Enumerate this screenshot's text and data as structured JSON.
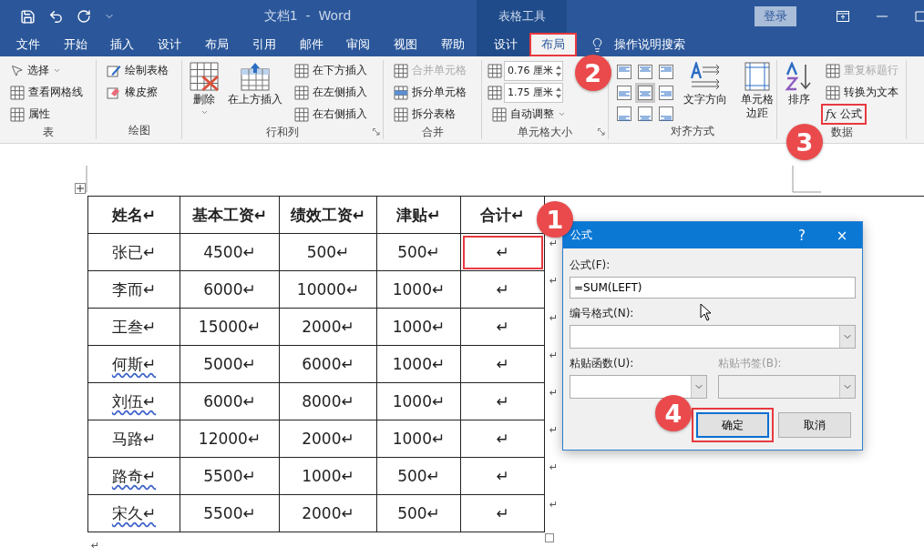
{
  "title_bar": {
    "document_title": "文档1  -  Word",
    "context_label": "表格工具",
    "login_button": "登录"
  },
  "tabs": [
    {
      "label": "文件",
      "kind": "main",
      "selected": false,
      "highlighted": false
    },
    {
      "label": "开始",
      "kind": "main",
      "selected": false,
      "highlighted": false
    },
    {
      "label": "插入",
      "kind": "main",
      "selected": false,
      "highlighted": false
    },
    {
      "label": "设计",
      "kind": "main",
      "selected": false,
      "highlighted": false
    },
    {
      "label": "布局",
      "kind": "main",
      "selected": false,
      "highlighted": false
    },
    {
      "label": "引用",
      "kind": "main",
      "selected": false,
      "highlighted": false
    },
    {
      "label": "邮件",
      "kind": "main",
      "selected": false,
      "highlighted": false
    },
    {
      "label": "审阅",
      "kind": "main",
      "selected": false,
      "highlighted": false
    },
    {
      "label": "视图",
      "kind": "main",
      "selected": false,
      "highlighted": false
    },
    {
      "label": "帮助",
      "kind": "main",
      "selected": false,
      "highlighted": false
    },
    {
      "label": "设计",
      "kind": "context",
      "selected": false,
      "highlighted": false
    },
    {
      "label": "布局",
      "kind": "context",
      "selected": true,
      "highlighted": true,
      "callout": "2"
    }
  ],
  "tell_me": "操作说明搜索",
  "ribbon": {
    "groups": [
      {
        "label": "表",
        "launcher": false,
        "columns": [
          {
            "kind": "stack",
            "items": [
              {
                "kind": "button",
                "label": "选择",
                "dropdown": true,
                "disabled": false,
                "highlighted": false
              },
              {
                "kind": "button",
                "label": "查看网格线",
                "dropdown": false,
                "disabled": false,
                "highlighted": false
              },
              {
                "kind": "button",
                "label": "属性",
                "dropdown": false,
                "disabled": false,
                "highlighted": false
              }
            ]
          }
        ]
      },
      {
        "label": "绘图",
        "launcher": false,
        "columns": [
          {
            "kind": "stack",
            "items": [
              {
                "kind": "button",
                "label": "绘制表格",
                "dropdown": false,
                "disabled": false,
                "highlighted": false
              },
              {
                "kind": "button",
                "label": "橡皮擦",
                "dropdown": false,
                "disabled": false,
                "highlighted": false
              }
            ]
          }
        ]
      },
      {
        "label": "行和列",
        "launcher": true,
        "columns": [
          {
            "kind": "large",
            "label": "删除",
            "dropdown": true
          },
          {
            "kind": "large",
            "label": "在上方插入",
            "dropdown": false
          },
          {
            "kind": "stack",
            "items": [
              {
                "kind": "button",
                "label": "在下方插入",
                "dropdown": false,
                "disabled": false,
                "highlighted": false
              },
              {
                "kind": "button",
                "label": "在左侧插入",
                "dropdown": false,
                "disabled": false,
                "highlighted": false
              },
              {
                "kind": "button",
                "label": "在右侧插入",
                "dropdown": false,
                "disabled": false,
                "highlighted": false
              }
            ]
          }
        ]
      },
      {
        "label": "合并",
        "launcher": false,
        "columns": [
          {
            "kind": "stack",
            "items": [
              {
                "kind": "button",
                "label": "合并单元格",
                "dropdown": false,
                "disabled": true,
                "highlighted": false
              },
              {
                "kind": "button",
                "label": "拆分单元格",
                "dropdown": false,
                "disabled": false,
                "highlighted": false
              },
              {
                "kind": "button",
                "label": "拆分表格",
                "dropdown": false,
                "disabled": false,
                "highlighted": false
              }
            ]
          }
        ]
      },
      {
        "label": "单元格大小",
        "launcher": true,
        "columns": [
          {
            "kind": "stack",
            "items": [
              {
                "kind": "spin",
                "value": "0.76 厘米"
              },
              {
                "kind": "spin",
                "value": "1.75 厘米"
              },
              {
                "kind": "button",
                "label": "自动调整",
                "dropdown": true,
                "disabled": false,
                "highlighted": false
              }
            ]
          }
        ]
      },
      {
        "label": "对齐方式",
        "launcher": false,
        "columns": [
          {
            "kind": "align",
            "cells": [
              {
                "selected": false
              },
              {
                "selected": false
              },
              {
                "selected": false
              },
              {
                "selected": false
              },
              {
                "selected": true
              },
              {
                "selected": false
              },
              {
                "selected": false
              },
              {
                "selected": false
              },
              {
                "selected": false
              }
            ]
          },
          {
            "kind": "large",
            "label": "文字方向",
            "dropdown": false
          },
          {
            "kind": "large",
            "label": "单元格边距",
            "dropdown": false
          }
        ]
      },
      {
        "label": "数据",
        "launcher": false,
        "columns": [
          {
            "kind": "large",
            "label": "排序",
            "dropdown": false
          },
          {
            "kind": "stack",
            "items": [
              {
                "kind": "button",
                "label": "重复标题行",
                "dropdown": false,
                "disabled": true,
                "highlighted": false
              },
              {
                "kind": "button",
                "label": "转换为文本",
                "dropdown": false,
                "disabled": false,
                "highlighted": false
              },
              {
                "kind": "button",
                "label": "公式",
                "glyph": "fx",
                "dropdown": false,
                "disabled": false,
                "highlighted": true,
                "callout": "3"
              }
            ]
          }
        ]
      }
    ]
  },
  "document": {
    "table": {
      "rows": [
        {
          "header": true,
          "cells": [
            {
              "text": "姓名↵"
            },
            {
              "text": "基本工资↵"
            },
            {
              "text": "绩效工资↵"
            },
            {
              "text": "津贴↵"
            },
            {
              "text": "合计↵"
            }
          ]
        },
        {
          "header": false,
          "end_mark": "↵",
          "cells": [
            {
              "text": "张已↵"
            },
            {
              "text": "4500↵"
            },
            {
              "text": "500↵"
            },
            {
              "text": "500↵"
            },
            {
              "text": "↵",
              "highlighted": true,
              "callout": "1"
            }
          ]
        },
        {
          "header": false,
          "end_mark": "↵",
          "cells": [
            {
              "text": "李而↵"
            },
            {
              "text": "6000↵"
            },
            {
              "text": "10000↵"
            },
            {
              "text": "1000↵"
            },
            {
              "text": "↵"
            }
          ]
        },
        {
          "header": false,
          "end_mark": "↵",
          "cells": [
            {
              "text": "王叁↵"
            },
            {
              "text": "15000↵"
            },
            {
              "text": "2000↵"
            },
            {
              "text": "1000↵"
            },
            {
              "text": "↵"
            }
          ]
        },
        {
          "header": false,
          "end_mark": "↵",
          "cells": [
            {
              "text": "何斯↵",
              "misspelled": true
            },
            {
              "text": "5000↵"
            },
            {
              "text": "6000↵"
            },
            {
              "text": "1000↵"
            },
            {
              "text": "↵"
            }
          ]
        },
        {
          "header": false,
          "end_mark": "↵",
          "cells": [
            {
              "text": "刘伍↵",
              "misspelled": true
            },
            {
              "text": "6000↵"
            },
            {
              "text": "8000↵"
            },
            {
              "text": "1000↵"
            },
            {
              "text": "↵"
            }
          ]
        },
        {
          "header": false,
          "end_mark": "↵",
          "cells": [
            {
              "text": "马路↵"
            },
            {
              "text": "12000↵"
            },
            {
              "text": "2000↵"
            },
            {
              "text": "1000↵"
            },
            {
              "text": "↵"
            }
          ]
        },
        {
          "header": false,
          "end_mark": "↵",
          "cells": [
            {
              "text": "路奇↵",
              "misspelled": true
            },
            {
              "text": "5500↵"
            },
            {
              "text": "1000↵"
            },
            {
              "text": "500↵"
            },
            {
              "text": "↵"
            }
          ]
        },
        {
          "header": false,
          "end_mark": "↵",
          "cells": [
            {
              "text": "宋久↵",
              "misspelled": true
            },
            {
              "text": "5500↵"
            },
            {
              "text": "2000↵"
            },
            {
              "text": "500↵"
            },
            {
              "text": "↵"
            }
          ]
        }
      ]
    },
    "trailing_mark": "↵"
  },
  "dialog": {
    "title": "公式",
    "help_button": "?",
    "close_button": "×",
    "formula": {
      "label": "公式(F):",
      "value": "=SUM(LEFT)"
    },
    "number_format": {
      "label": "编号格式(N):"
    },
    "paste_fields": [
      {
        "label": "粘贴函数(U):",
        "disabled": false
      },
      {
        "label": "粘贴书签(B):",
        "disabled": true
      }
    ],
    "buttons": [
      {
        "label": "确定",
        "default": true,
        "highlighted": true,
        "callout": "4"
      },
      {
        "label": "取消",
        "default": false,
        "highlighted": false
      }
    ]
  }
}
